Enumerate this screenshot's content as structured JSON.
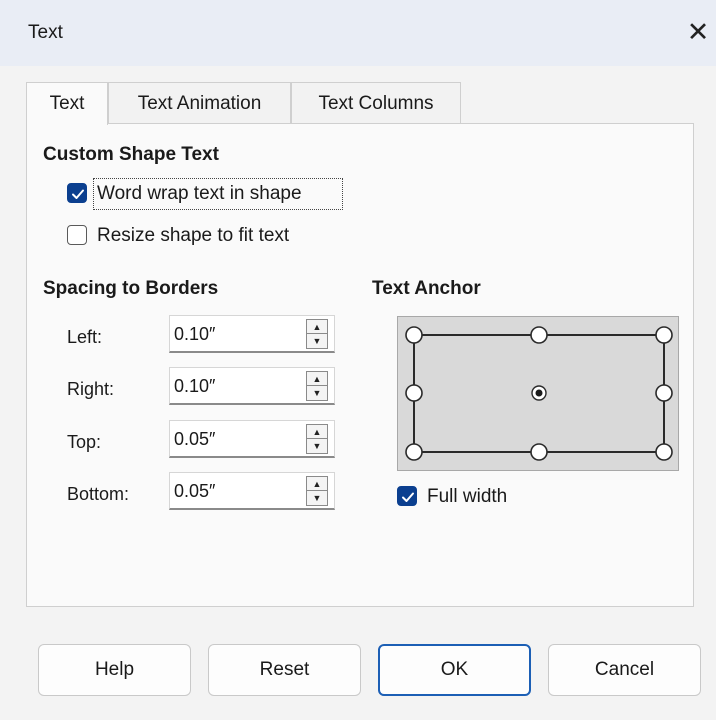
{
  "window": {
    "title": "Text",
    "close_glyph": "✕"
  },
  "tabs": [
    {
      "label": "Text",
      "active": true
    },
    {
      "label": "Text Animation",
      "active": false
    },
    {
      "label": "Text Columns",
      "active": false
    }
  ],
  "custom_shape": {
    "heading": "Custom Shape Text",
    "word_wrap": {
      "label": "Word wrap text in shape",
      "checked": true
    },
    "resize": {
      "label": "Resize shape to fit text",
      "checked": false
    }
  },
  "spacing": {
    "heading": "Spacing to Borders",
    "rows": [
      {
        "label": "Left:",
        "value": "0.10″"
      },
      {
        "label": "Right:",
        "value": "0.10″"
      },
      {
        "label": "Top:",
        "value": "0.05″"
      },
      {
        "label": "Bottom:",
        "value": "0.05″"
      }
    ]
  },
  "anchor": {
    "heading": "Text Anchor",
    "selected": "center",
    "full_width": {
      "label": "Full width",
      "checked": true
    }
  },
  "footer": {
    "help": "Help",
    "reset": "Reset",
    "ok": "OK",
    "cancel": "Cancel"
  },
  "colors": {
    "accent": "#0b3f8f",
    "focus_border": "#1c5fb5"
  }
}
